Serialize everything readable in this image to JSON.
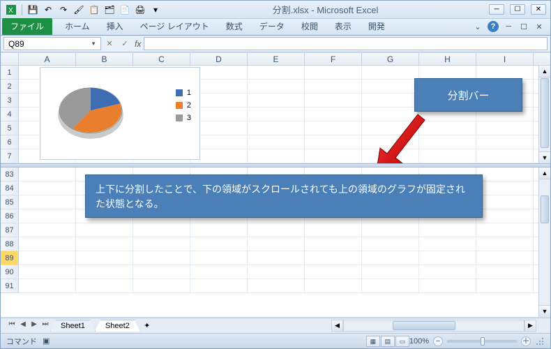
{
  "title": "分割.xlsx - Microsoft Excel",
  "ribbon": {
    "file": "ファイル",
    "tabs": [
      "ホーム",
      "挿入",
      "ページ レイアウト",
      "数式",
      "データ",
      "校閲",
      "表示",
      "開発"
    ]
  },
  "namebox": "Q89",
  "columns": [
    "A",
    "B",
    "C",
    "D",
    "E",
    "F",
    "G",
    "H",
    "I"
  ],
  "top_rows": [
    "1",
    "2",
    "3",
    "4",
    "5",
    "6",
    "7"
  ],
  "bottom_rows": [
    "83",
    "84",
    "85",
    "86",
    "87",
    "88",
    "89",
    "90",
    "91"
  ],
  "selected_row": "89",
  "chart_data": {
    "type": "pie",
    "categories": [
      "1",
      "2",
      "3"
    ],
    "values": [
      20,
      40,
      40
    ],
    "colors": [
      "#3d6db3",
      "#e97f2e",
      "#9a9a9a"
    ],
    "legend": [
      "1",
      "2",
      "3"
    ]
  },
  "callout1": "分割バー",
  "callout2": "上下に分割したことで、下の領域がスクロールされても上の領域のグラフが固定された状態となる。",
  "sheet_tabs": [
    "Sheet1",
    "Sheet2"
  ],
  "active_sheet": "Sheet2",
  "status": "コマンド",
  "zoom": "100%",
  "zoom_minus": "−",
  "zoom_plus": "＋"
}
